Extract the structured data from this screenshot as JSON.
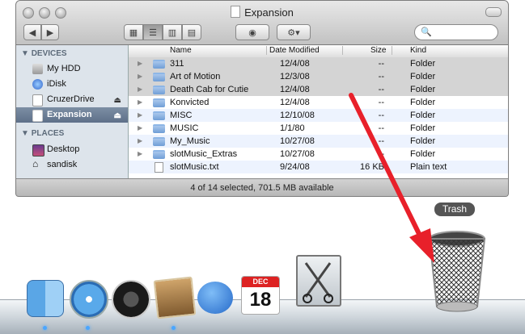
{
  "window": {
    "title": "Expansion",
    "search_placeholder": ""
  },
  "sidebar": {
    "sections": [
      {
        "heading": "DEVICES",
        "items": [
          {
            "label": "My HDD",
            "icon": "hard-drive-icon"
          },
          {
            "label": "iDisk",
            "icon": "idisk-icon"
          },
          {
            "label": "CruzerDrive",
            "icon": "usb-drive-icon",
            "eject": "⏏"
          },
          {
            "label": "Expansion",
            "icon": "drive-icon",
            "eject": "⏏",
            "selected": true
          }
        ]
      },
      {
        "heading": "PLACES",
        "items": [
          {
            "label": "Desktop",
            "icon": "desktop-icon"
          },
          {
            "label": "sandisk",
            "icon": "home-icon"
          }
        ]
      }
    ]
  },
  "columns": {
    "name": "Name",
    "date": "Date Modified",
    "size": "Size",
    "kind": "Kind"
  },
  "rows": [
    {
      "name": "311",
      "date": "12/4/08",
      "size": "--",
      "kind": "Folder",
      "selected": true
    },
    {
      "name": "Art of Motion",
      "date": "12/3/08",
      "size": "--",
      "kind": "Folder",
      "selected": true
    },
    {
      "name": "Death Cab for Cutie",
      "date": "12/4/08",
      "size": "--",
      "kind": "Folder",
      "selected": true
    },
    {
      "name": "Konvicted",
      "date": "12/4/08",
      "size": "--",
      "kind": "Folder"
    },
    {
      "name": "MISC",
      "date": "12/10/08",
      "size": "--",
      "kind": "Folder"
    },
    {
      "name": "MUSIC",
      "date": "1/1/80",
      "size": "--",
      "kind": "Folder"
    },
    {
      "name": "My_Music",
      "date": "10/27/08",
      "size": "--",
      "kind": "Folder"
    },
    {
      "name": "slotMusic_Extras",
      "date": "10/27/08",
      "size": "--",
      "kind": "Folder"
    },
    {
      "name": "slotMusic.txt",
      "date": "9/24/08",
      "size": "16 KB",
      "kind": "Plain text",
      "file": true
    }
  ],
  "status": "4 of 14 selected, 701.5 MB available",
  "dock": {
    "trash_label": "Trash",
    "calendar_month": "DEC",
    "calendar_day": "18"
  },
  "accent_color": "#e8202a"
}
